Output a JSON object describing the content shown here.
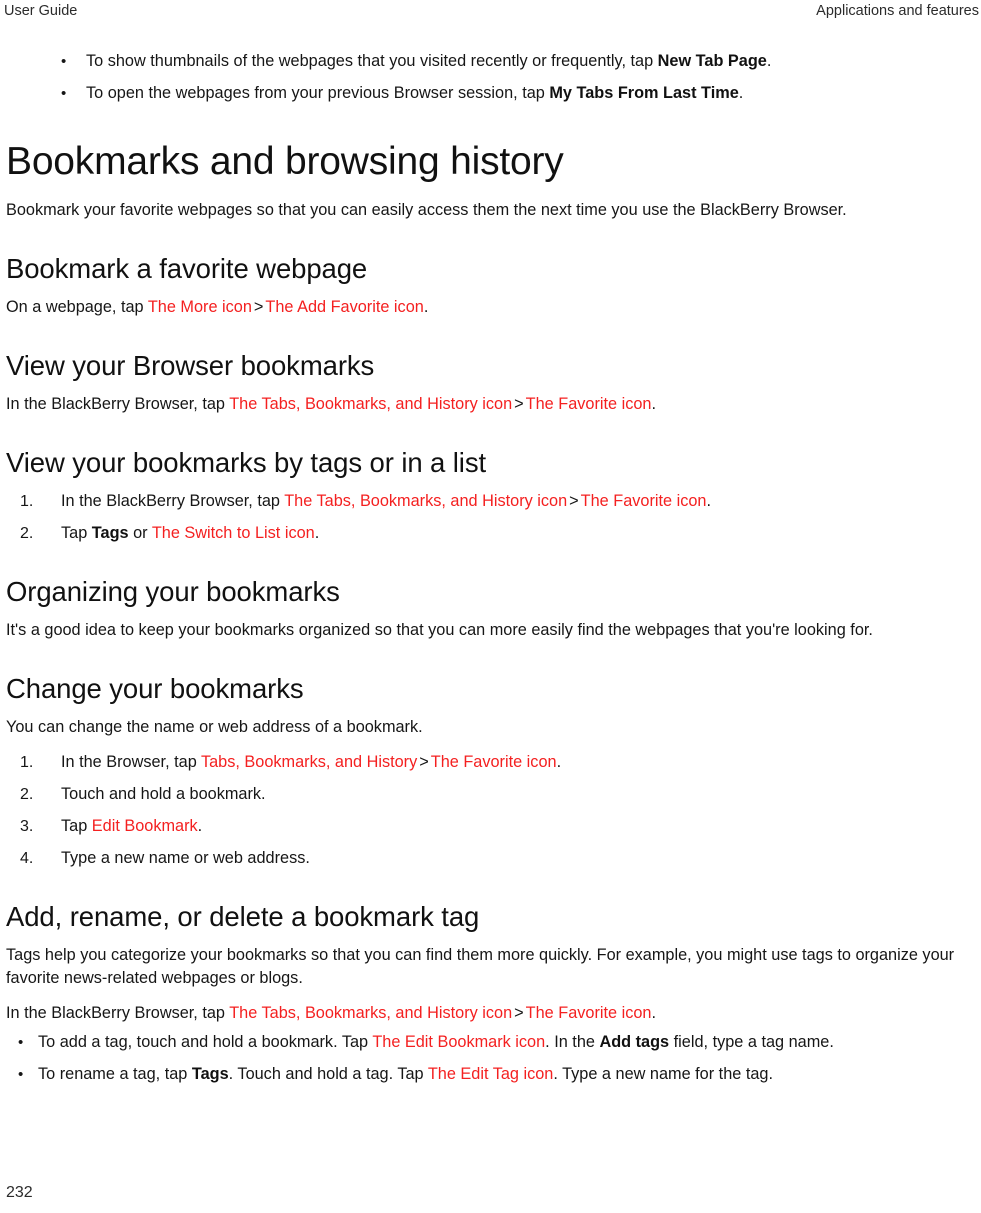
{
  "header": {
    "left": "User Guide",
    "right": "Applications and features"
  },
  "footer": {
    "page_number": "232"
  },
  "colors": {
    "icon_reference": "#F42020",
    "body_text": "#161616",
    "heading_text": "#111111"
  },
  "top_bullets": [
    {
      "prefix": "To show thumbnails of the webpages that you visited recently or frequently, tap ",
      "bold": "New Tab Page",
      "suffix": "."
    },
    {
      "prefix": "To open the webpages from your previous Browser session, tap ",
      "bold": "My Tabs From Last Time",
      "suffix": "."
    }
  ],
  "sections": {
    "bookmarks_and_browsing_history": {
      "title": "Bookmarks and browsing history",
      "intro": "Bookmark your favorite webpages so that you can easily access them the next time you use the BlackBerry Browser."
    },
    "bookmark_a_favorite_webpage": {
      "title": "Bookmark a favorite webpage",
      "step_prefix": "On a webpage, tap ",
      "icon1": "The More icon",
      "chevron": ">",
      "icon2": "The Add Favorite icon",
      "period": "."
    },
    "view_your_browser_bookmarks": {
      "title": "View your Browser bookmarks",
      "step_prefix": "In the BlackBerry Browser, tap ",
      "icon1": "The Tabs, Bookmarks, and History icon",
      "chevron": ">",
      "icon2": "The Favorite icon",
      "period": "."
    },
    "view_your_bookmarks_by_tags_or_in_a_list": {
      "title": "View your bookmarks by tags or in a list",
      "steps": [
        {
          "prefix": "In the BlackBerry Browser, tap ",
          "icon1": "The Tabs, Bookmarks, and History icon",
          "chevron": ">",
          "icon2": "The Favorite icon",
          "period": "."
        },
        {
          "prefix": "Tap ",
          "bold": "Tags",
          "mid": " or ",
          "icon1": "The Switch to List icon",
          "period": "."
        }
      ]
    },
    "organizing_your_bookmarks": {
      "title": "Organizing your bookmarks",
      "intro": "It's a good idea to keep your bookmarks organized so that you can more easily find the webpages that you're looking for."
    },
    "change_your_bookmarks": {
      "title": "Change your bookmarks",
      "intro": "You can change the name or web address of a bookmark.",
      "steps": [
        {
          "prefix": "In the Browser, tap ",
          "icon1": "Tabs, Bookmarks, and History",
          "chevron": ">",
          "icon2": "The Favorite icon",
          "period": "."
        },
        {
          "text": "Touch and hold a bookmark."
        },
        {
          "prefix": "Tap ",
          "icon1": "Edit Bookmark",
          "period": "."
        },
        {
          "text": "Type a new name or web address."
        }
      ]
    },
    "add_rename_or_delete_a_bookmark_tag": {
      "title": "Add, rename, or delete a bookmark tag",
      "intro": "Tags help you categorize your bookmarks so that you can find them more quickly. For example, you might use tags to organize your favorite news-related webpages or blogs.",
      "lead": {
        "prefix": "In the BlackBerry Browser, tap ",
        "icon1": "The Tabs, Bookmarks, and History icon",
        "chevron": ">",
        "icon2": "The Favorite icon",
        "period": "."
      },
      "bullets": [
        {
          "prefix": "To add a tag, touch and hold a bookmark. Tap ",
          "icon1": "The Edit Bookmark icon",
          "mid": ". In the ",
          "bold": "Add tags",
          "suffix": " field, type a tag name."
        },
        {
          "prefix": "To rename a tag, tap ",
          "bold": "Tags",
          "mid": ". Touch and hold a tag. Tap ",
          "icon1": "The Edit Tag icon",
          "suffix": ". Type a new name for the tag."
        }
      ]
    }
  }
}
